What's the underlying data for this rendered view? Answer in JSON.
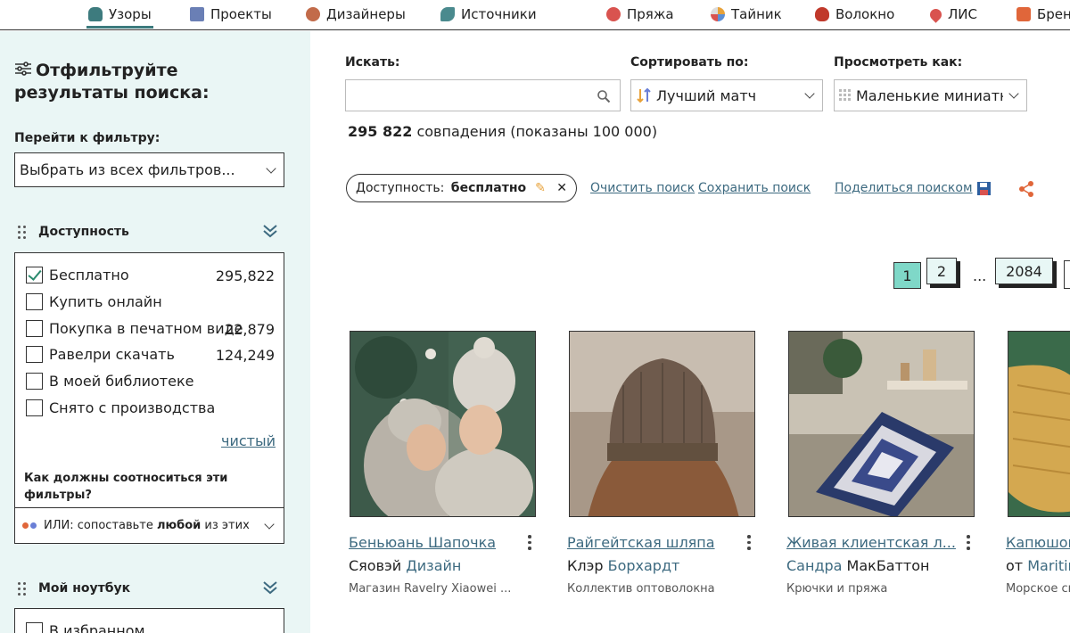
{
  "nav": {
    "items": [
      {
        "label": "Узоры",
        "active": true,
        "color": "#3d7b7e"
      },
      {
        "label": "Проекты",
        "color": "#6a7fb5"
      },
      {
        "label": "Дизайнеры",
        "color": "#c26b4a"
      },
      {
        "label": "Источники",
        "color": "#4a8a8e"
      },
      {
        "label": "Пряжа",
        "color": "#d9534f"
      },
      {
        "label": "Тайник",
        "color": "#e8a23a"
      },
      {
        "label": "Волокно",
        "color": "#c0392b"
      },
      {
        "label": "ЛИС",
        "color": "#d9534f"
      },
      {
        "label": "Бренды",
        "color": "#e0663a"
      }
    ]
  },
  "sidebar": {
    "title": "Отфильтруйте результаты поиска:",
    "goto_label": "Перейти к фильтру:",
    "goto_value": "Выбрать из всех фильтров...",
    "availability": {
      "heading": "Доступность",
      "options": [
        {
          "label": "Бесплатно",
          "count": "295,822",
          "checked": true
        },
        {
          "label": "Купить онлайн",
          "count": "",
          "checked": false
        },
        {
          "label": "Покупка в печатном виде",
          "count": "22,879",
          "checked": false
        },
        {
          "label": "Равелри скачать",
          "count": "124,249",
          "checked": false
        },
        {
          "label": "В моей библиотеке",
          "count": "",
          "checked": false
        },
        {
          "label": "Снято с производства",
          "count": "",
          "checked": false
        }
      ],
      "clear_label": "чистый",
      "relation_question": "Как должны соотноситься эти фильтры?",
      "relation_prefix": "ИЛИ: сопоставьте ",
      "relation_bold": "любой",
      "relation_suffix": " из этих"
    },
    "notebook": {
      "heading": "Мой ноутбук",
      "first_option": "В избранном"
    }
  },
  "search": {
    "label": "Искать:",
    "value": "",
    "sort_label": "Сортировать по:",
    "sort_value": "Лучший матч",
    "view_label": "Просмотреть как:",
    "view_value": "Маленькие миниатюры",
    "results_count": "295 822",
    "results_text": " совпадения (показаны 100 000)"
  },
  "filter_pill": {
    "key": "Доступность:",
    "value": "бесплатно"
  },
  "actions": {
    "clear": "Очистить поиск",
    "save": "Сохранить поиск",
    "share": "Поделиться поиском"
  },
  "pagination": {
    "pages": [
      "1",
      "2"
    ],
    "ellipsis": "...",
    "last": "2084",
    "active_color": "#7fd8c8"
  },
  "cards": [
    {
      "title": "Беньюань Шапочка",
      "author_plain": "Сяовэй ",
      "author_link": "Дизайн",
      "source": "Магазин Ravelry Xiaowei ..."
    },
    {
      "title": "Райгейтская шляпа",
      "author_plain": "Клэр ",
      "author_link": "Борхардт",
      "source": "Коллектив оптоволокна"
    },
    {
      "title": "Живая клиентская л...",
      "author_plain": "",
      "author_link": "Сандра",
      "author_plain2": " МакБаттон",
      "source": "Крючки и пряжа"
    },
    {
      "title": "Капюшон",
      "author_plain": "от ",
      "author_link": "Maritime",
      "source": "Морское свет"
    }
  ]
}
